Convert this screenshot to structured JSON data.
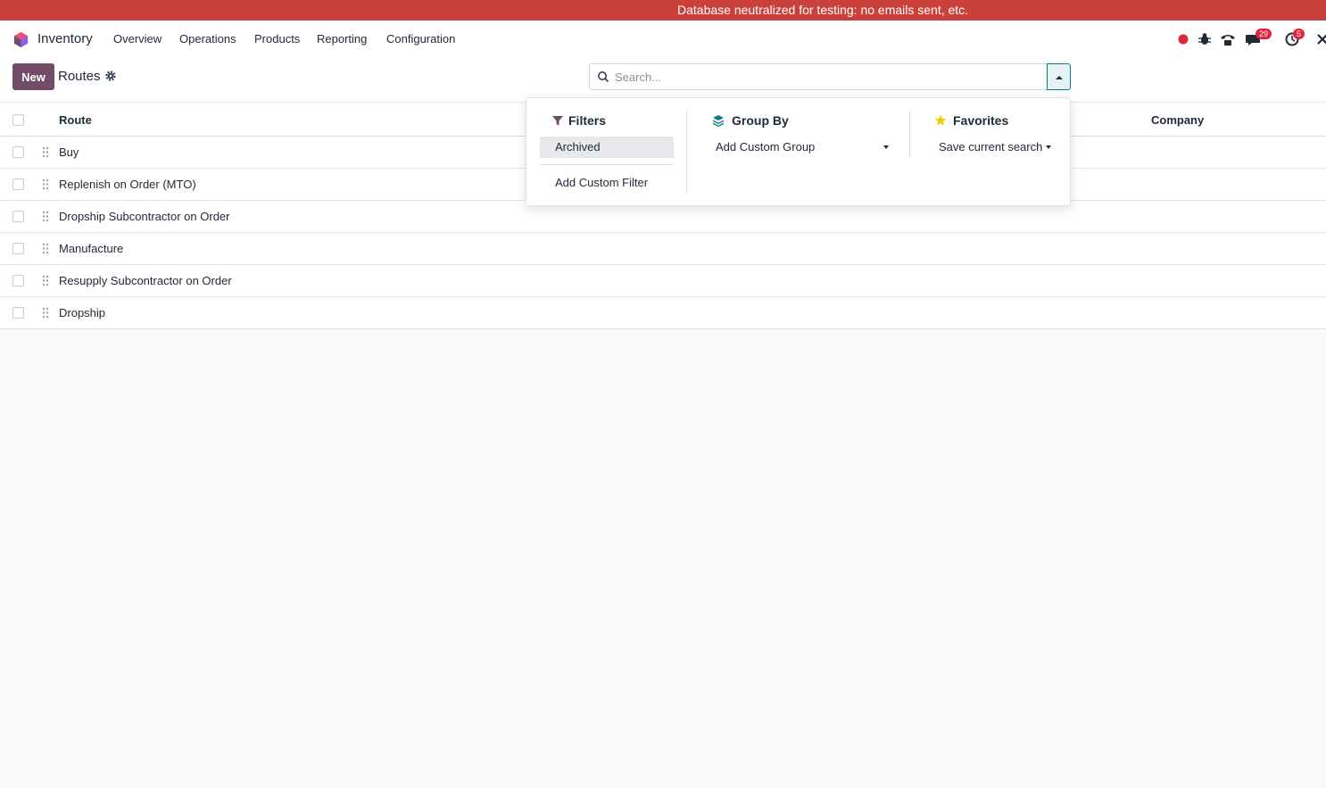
{
  "banner": {
    "text": "Database neutralized for testing: no emails sent, etc."
  },
  "navbar": {
    "app_name": "Inventory",
    "menu": [
      "Overview",
      "Operations",
      "Products",
      "Reporting",
      "Configuration"
    ],
    "badges": {
      "messages": "29",
      "activities": "5"
    },
    "colors": {
      "recording_dot": "#e0263c",
      "badge": "#e0263c"
    }
  },
  "control_panel": {
    "new_label": "New",
    "breadcrumb": "Routes",
    "search_placeholder": "Search..."
  },
  "list": {
    "columns": [
      "Route",
      "Company"
    ],
    "rows": [
      "Buy",
      "Replenish on Order (MTO)",
      "Dropship Subcontractor on Order",
      "Manufacture",
      "Resupply Subcontractor on Order",
      "Dropship"
    ]
  },
  "search_panel": {
    "filters": {
      "title": "Filters",
      "items": [
        "Archived"
      ],
      "custom": "Add Custom Filter"
    },
    "group_by": {
      "title": "Group By",
      "custom": "Add Custom Group"
    },
    "favorites": {
      "title": "Favorites",
      "save": "Save current search"
    }
  },
  "theme": {
    "primary": "#714b67",
    "accent": "#017e84",
    "banner": "#c9413a"
  }
}
